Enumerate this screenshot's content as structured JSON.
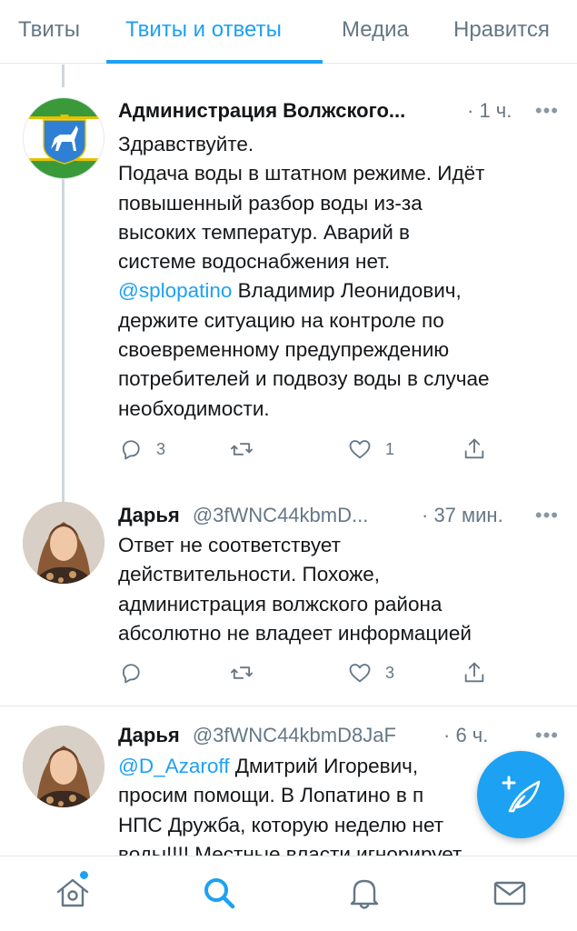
{
  "tabs": [
    {
      "label": "Твиты"
    },
    {
      "label": "Твиты и ответы"
    },
    {
      "label": "Медиа"
    },
    {
      "label": "Нравится"
    }
  ],
  "active_tab": "Твиты и ответы",
  "tweets": [
    {
      "name": "Администрация Волжского...",
      "handle": "",
      "time": "· 1 ч.",
      "body_lines": [
        "Здравствуйте.",
        "Подача воды в штатном режиме. Идёт",
        "повышенный разбор воды из-за",
        "высоких температур. Аварий в",
        "системе водоснабжения нет."
      ],
      "mention": "@splopatino",
      "mention_rest": " Владимир Леонидович,",
      "body_lines_after": [
        "держите ситуацию на контроле по",
        "своевременному предупреждению",
        "потребителей и подвозу воды в случае",
        "необходимости."
      ],
      "reply_count": "3",
      "retweet_count": "",
      "like_count": "1"
    },
    {
      "name": "Дарья",
      "handle": "@3fWNC44kbmD...",
      "time": "· 37 мин.",
      "body_lines": [
        "Ответ не соответствует",
        "действительности.  Похоже,",
        "администрация волжского района",
        "абсолютно не владеет информацией"
      ],
      "reply_count": "",
      "retweet_count": "",
      "like_count": "3"
    },
    {
      "name": "Дарья",
      "handle": "@3fWNC44kbmD8JaF",
      "time": "· 6 ч.",
      "mention": "@D_Azaroff",
      "mention_rest": " Дмитрий Игоревич,",
      "body_lines_after": [
        "просим помощи. В Лопатино в п",
        "НПС Дружба, которую неделю нет",
        "воды!!!! Местные власти игнорирует"
      ]
    }
  ],
  "more_label": "•••",
  "colors": {
    "accent": "#1da1f2",
    "text": "#14171a",
    "secondary": "#657786",
    "border": "#e1e8ed"
  },
  "icons": {
    "reply": "reply-icon",
    "retweet": "retweet-icon",
    "like": "heart-icon",
    "share": "share-icon",
    "compose": "compose-tweet-icon",
    "home": "home-icon",
    "search": "search-icon",
    "notifications": "bell-icon",
    "messages": "envelope-icon"
  }
}
